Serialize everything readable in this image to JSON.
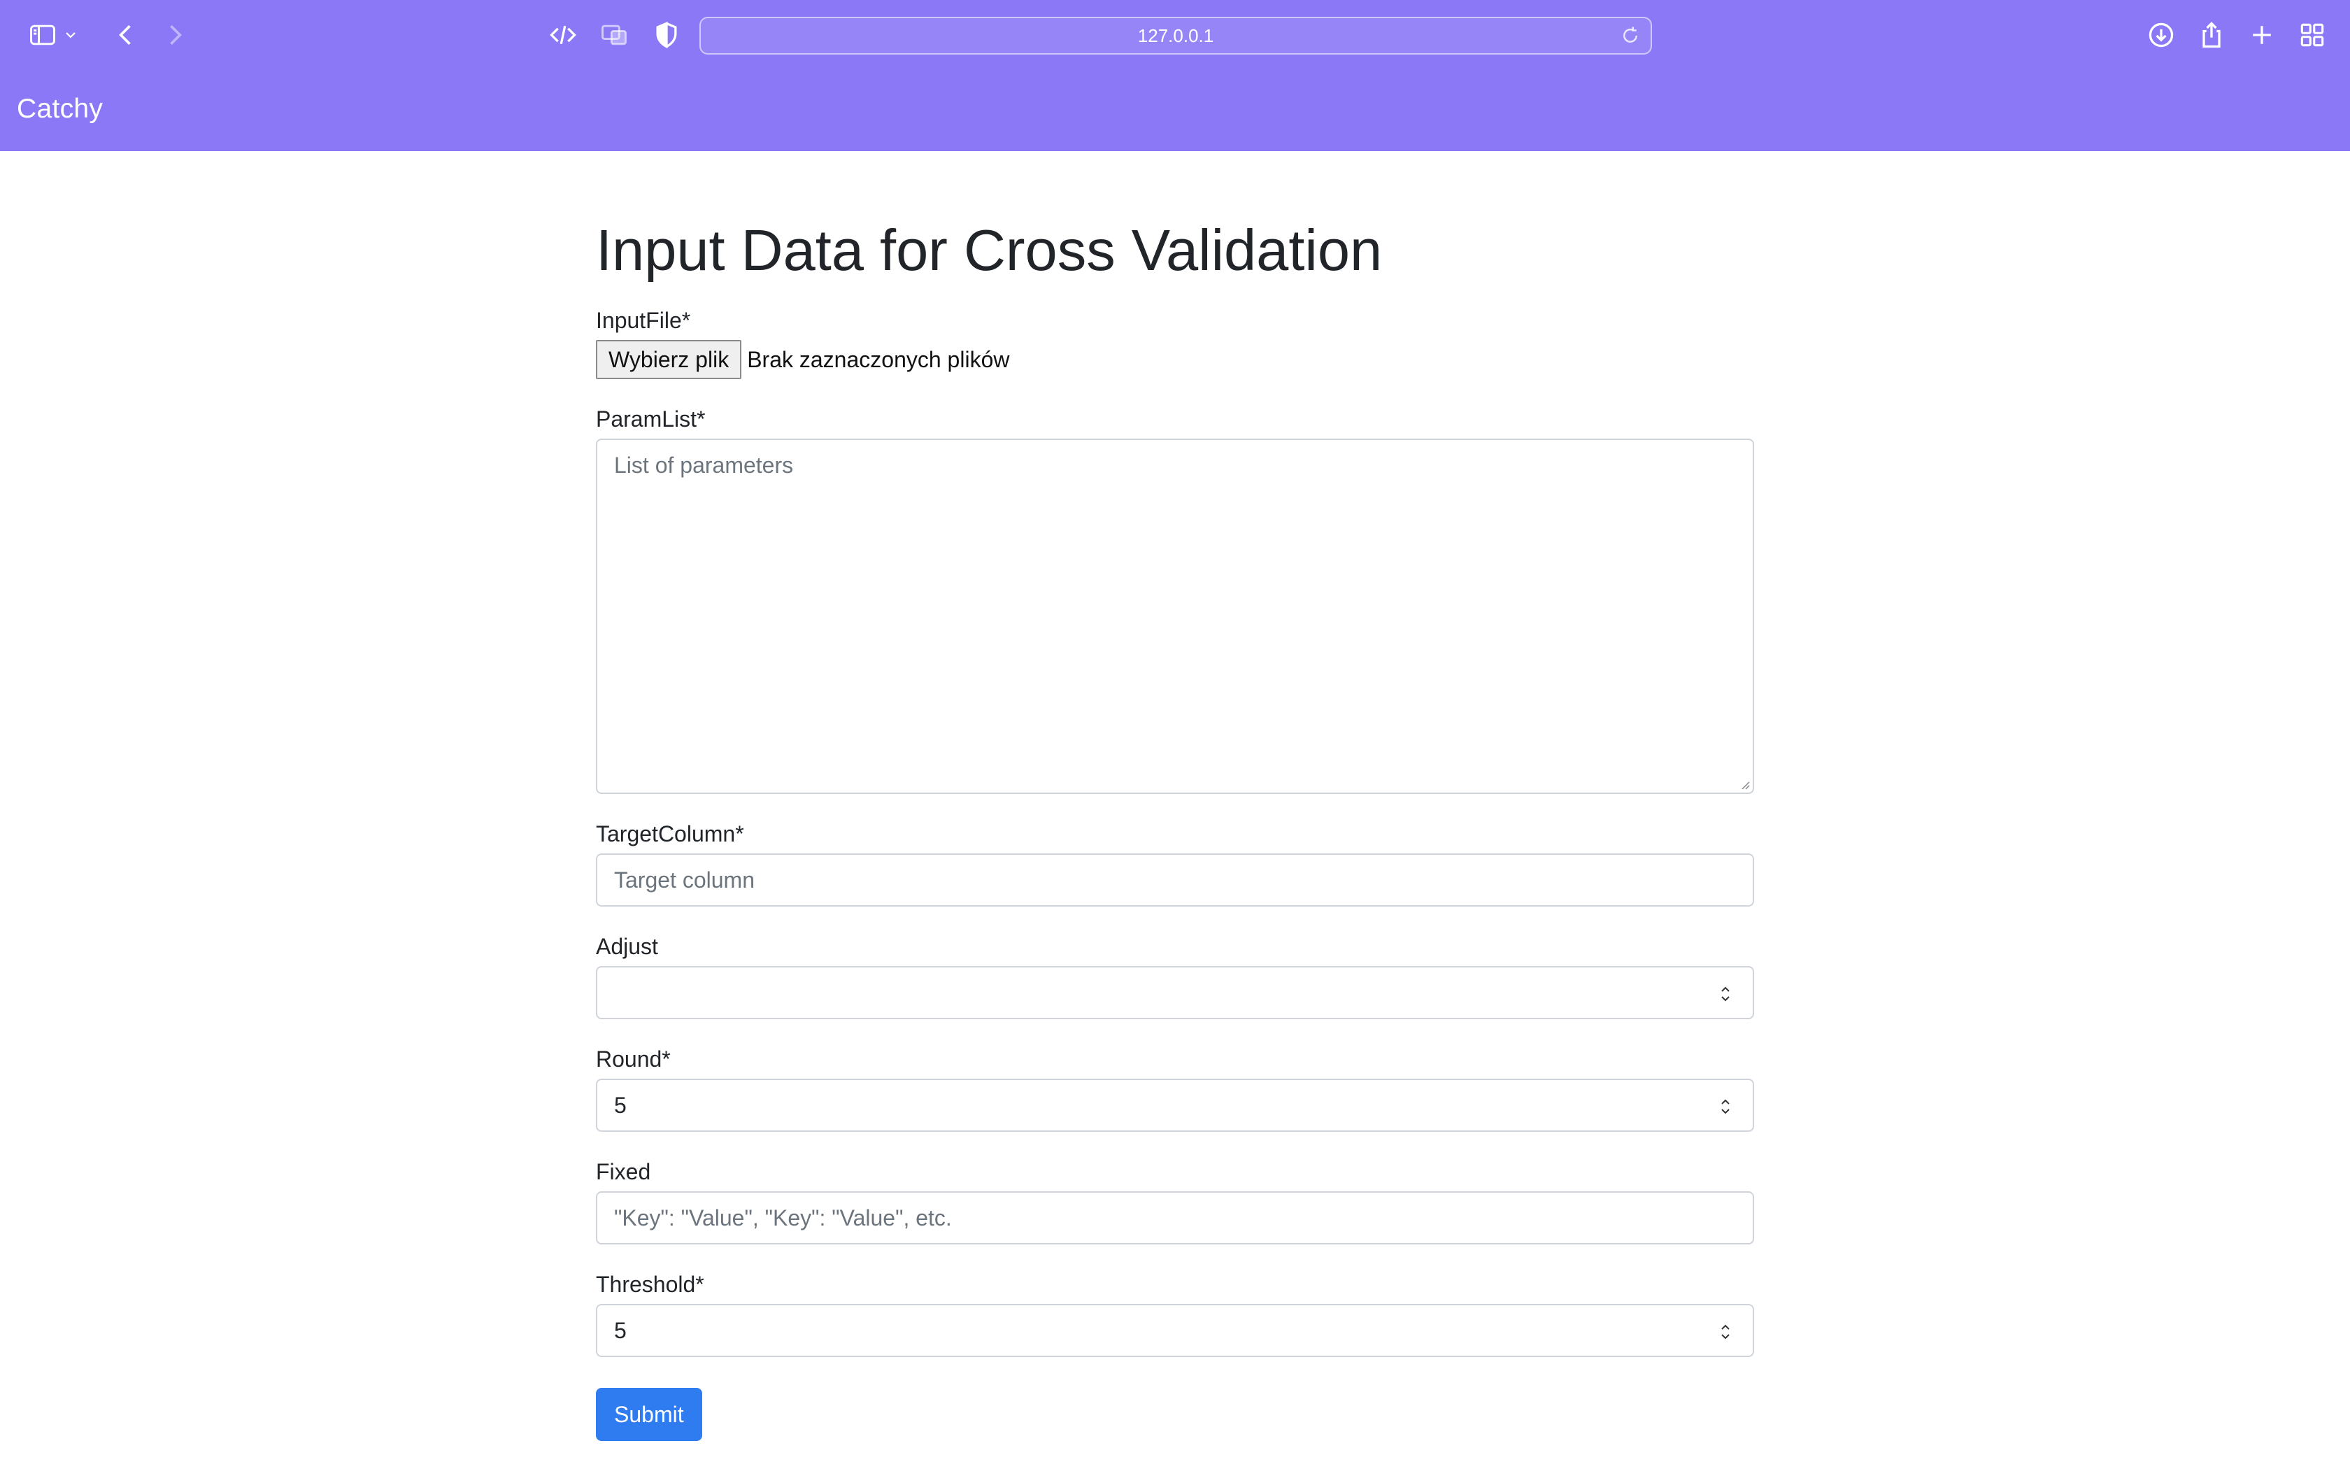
{
  "browser": {
    "url": "127.0.0.1"
  },
  "navbar": {
    "brand": "Catchy",
    "background": "#8b78f6"
  },
  "page": {
    "title": "Input Data for Cross Validation"
  },
  "form": {
    "input_file": {
      "label": "InputFile*",
      "button_label": "Wybierz plik",
      "status": "Brak zaznaczonych plików"
    },
    "param_list": {
      "label": "ParamList*",
      "placeholder": "List of parameters"
    },
    "target_column": {
      "label": "TargetColumn*",
      "placeholder": "Target column"
    },
    "adjust": {
      "label": "Adjust",
      "value": ""
    },
    "round": {
      "label": "Round*",
      "value": "5"
    },
    "fixed": {
      "label": "Fixed",
      "placeholder": "\"Key\": \"Value\", \"Key\": \"Value\", etc."
    },
    "threshold": {
      "label": "Threshold*",
      "value": "5"
    },
    "submit_label": "Submit",
    "submit_color": "#2f7bf0"
  }
}
